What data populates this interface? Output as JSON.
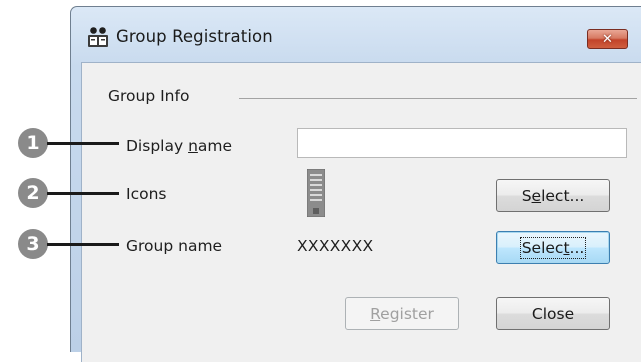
{
  "window": {
    "title": "Group Registration",
    "close_glyph": "✕",
    "app_icon": "group-registration-icon"
  },
  "form": {
    "group_info_label": "Group Info",
    "display_name_label_pre": "Display ",
    "display_name_label_mnemonic": "n",
    "display_name_label_post": "ame",
    "display_name_value": "",
    "icons_label": "Icons",
    "icon_image": "server-tower-icon",
    "group_name_label": "Group name",
    "group_name_value": "XXXXXXX"
  },
  "buttons": {
    "select_icons_pre": "S",
    "select_icons_mnemonic": "e",
    "select_icons_post": "lect...",
    "select_group_pre": "Selec",
    "select_group_mnemonic": "t",
    "select_group_post": "...",
    "register_mnemonic": "R",
    "register_post": "egister",
    "close_label": "Close"
  },
  "callouts": [
    "1",
    "2",
    "3"
  ],
  "colors": {
    "title_bar": "#c8daee",
    "client_bg": "#f0f0f0",
    "close_button": "#c2432a",
    "callout_dot": "#8a8a8a",
    "focused_button": "#bee6fd"
  }
}
